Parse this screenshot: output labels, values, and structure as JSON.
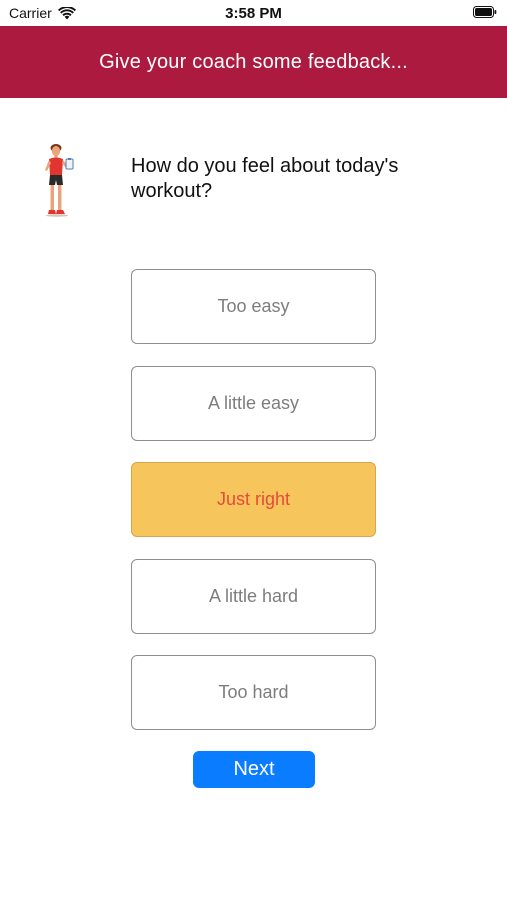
{
  "status_bar": {
    "carrier": "Carrier",
    "time": "3:58 PM",
    "wifi_icon": "wifi-icon",
    "battery_icon": "battery-icon"
  },
  "header": {
    "title": "Give your coach some feedback...",
    "background_color": "#ac1a3f"
  },
  "question": {
    "illustration_icon": "coach-with-clipboard-icon",
    "text": "How do you feel about today's workout?"
  },
  "options": [
    {
      "label": "Too easy",
      "selected": false
    },
    {
      "label": "A little easy",
      "selected": false
    },
    {
      "label": "Just right",
      "selected": true
    },
    {
      "label": "A little hard",
      "selected": false
    },
    {
      "label": "Too hard",
      "selected": false
    }
  ],
  "colors": {
    "selected_background": "#f6c65c",
    "selected_text": "#e8493a",
    "primary_button": "#0a7cff"
  },
  "next_button": {
    "label": "Next"
  }
}
